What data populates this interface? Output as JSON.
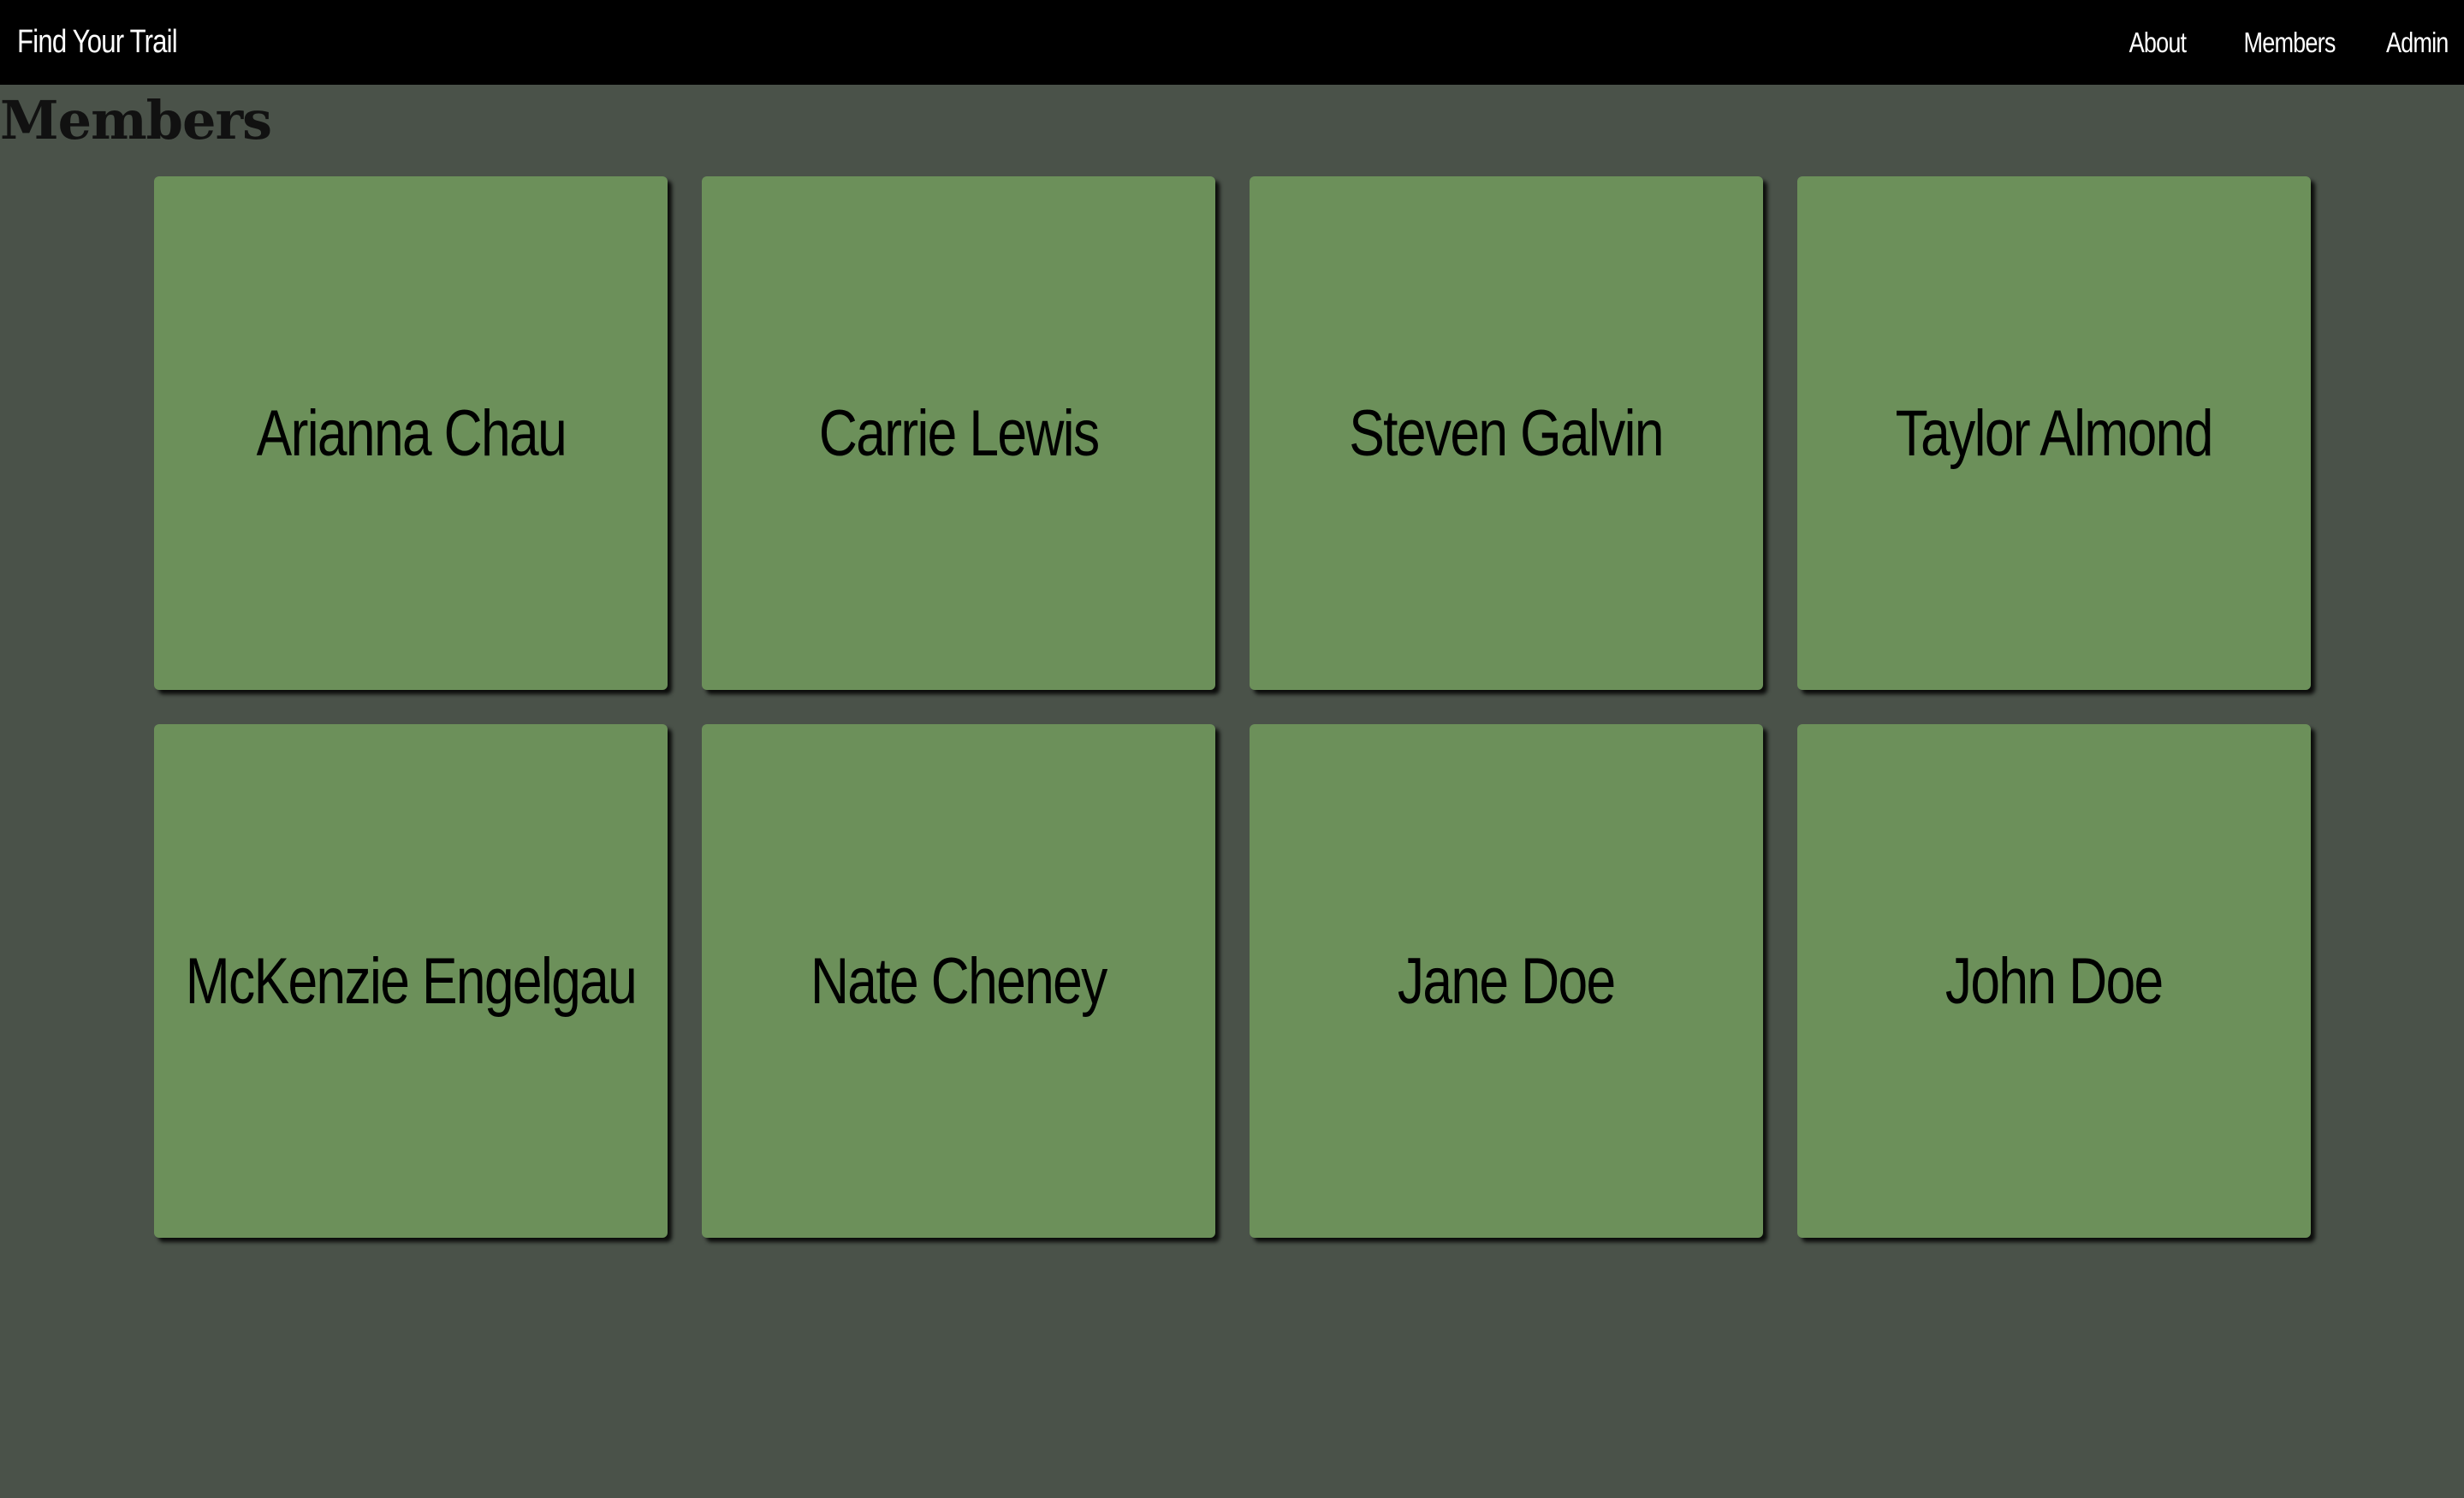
{
  "navbar": {
    "brand": "Find Your Trail",
    "links": [
      {
        "label": "About"
      },
      {
        "label": "Members"
      },
      {
        "label": "Admin"
      }
    ]
  },
  "page": {
    "title": "Members"
  },
  "members": [
    {
      "name": "Arianna Chau"
    },
    {
      "name": "Carrie Lewis"
    },
    {
      "name": "Steven Galvin"
    },
    {
      "name": "Taylor Almond"
    },
    {
      "name": "McKenzie Engelgau"
    },
    {
      "name": "Nate Cheney"
    },
    {
      "name": "Jane Doe"
    },
    {
      "name": "John Doe"
    }
  ],
  "colors": {
    "navbar_bg": "#000000",
    "page_bg": "#4a5249",
    "card_bg": "#6c905a"
  }
}
